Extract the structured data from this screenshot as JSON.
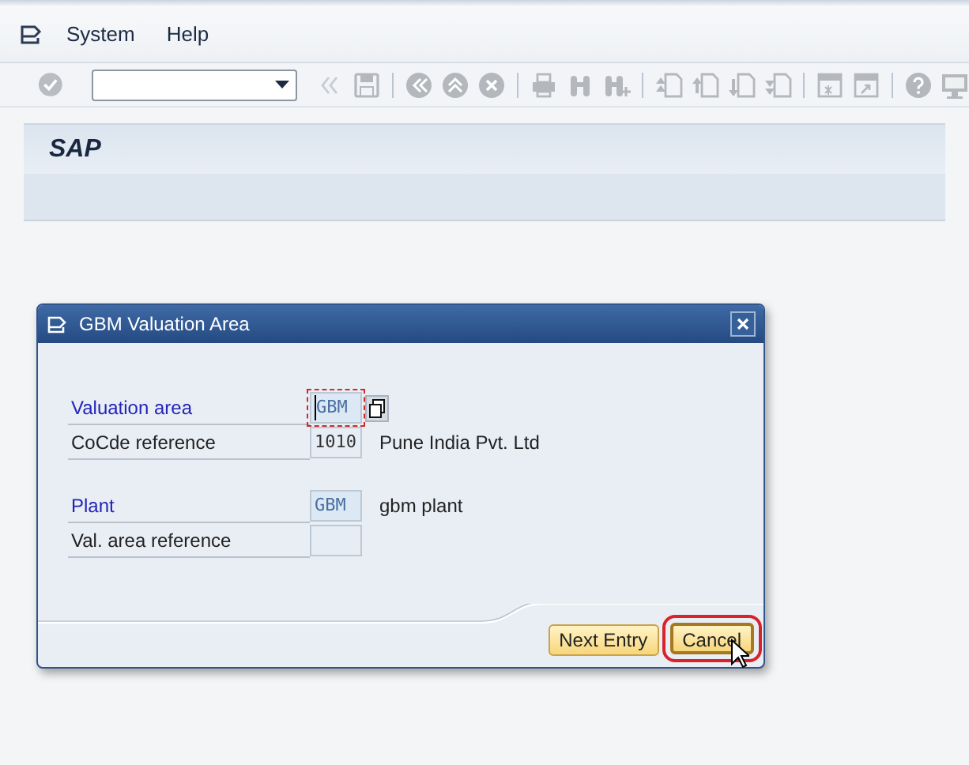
{
  "menu": [
    "System",
    "Help"
  ],
  "screen_title": "SAP",
  "dialog": {
    "title": "GBM Valuation Area",
    "groups": [
      [
        {
          "label": "Valuation area",
          "required": true,
          "value": "GBM",
          "focused": true,
          "search_help": true
        },
        {
          "label": "CoCde reference",
          "required": false,
          "value": "1010",
          "focused": false,
          "search_help": false,
          "description": "Pune India Pvt. Ltd"
        }
      ],
      [
        {
          "label": "Plant",
          "required": true,
          "value": "GBM",
          "focused": false,
          "search_help": false,
          "description": "gbm plant"
        },
        {
          "label": "Val. area reference",
          "required": false,
          "focused": false,
          "search_help": false
        }
      ]
    ],
    "buttons": [
      {
        "label": "Next Entry",
        "highlighted": false
      },
      {
        "label": "Cancel",
        "highlighted": true
      }
    ]
  }
}
